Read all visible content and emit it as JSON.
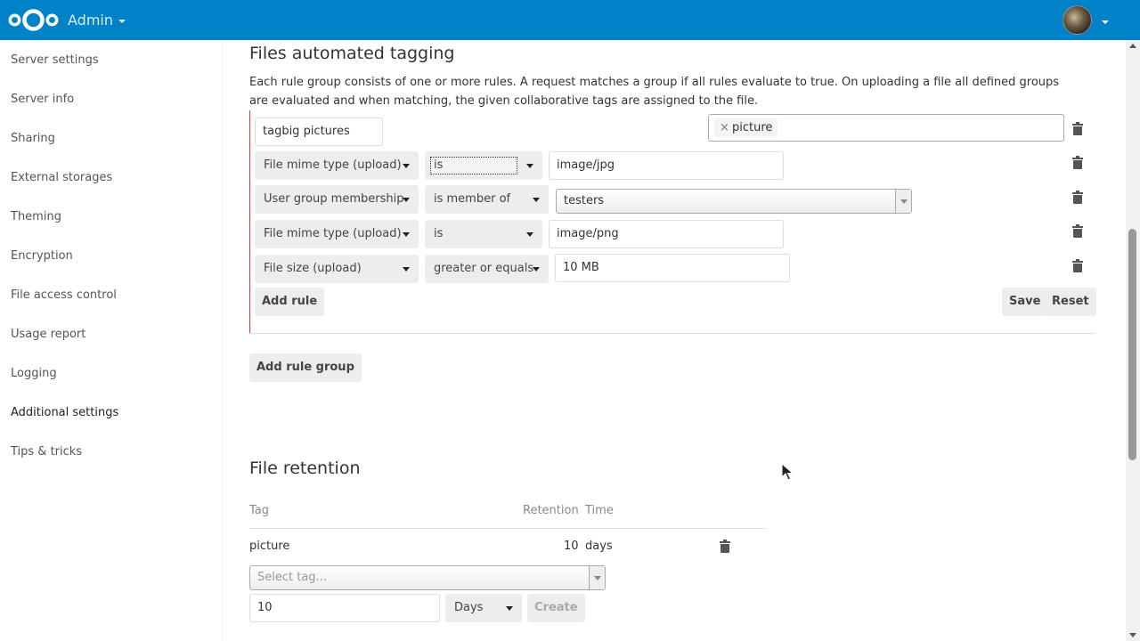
{
  "header": {
    "app_title": "Admin",
    "logo": "nextcloud-logo",
    "brand_color": "#0082c9"
  },
  "sidebar": {
    "items": [
      {
        "label": "Server settings"
      },
      {
        "label": "Server info"
      },
      {
        "label": "Sharing"
      },
      {
        "label": "External storages"
      },
      {
        "label": "Theming"
      },
      {
        "label": "Encryption"
      },
      {
        "label": "File access control"
      },
      {
        "label": "Usage report"
      },
      {
        "label": "Logging"
      },
      {
        "label": "Additional settings",
        "active": true
      },
      {
        "label": "Tips & tricks"
      }
    ]
  },
  "tagging": {
    "title": "Files automated tagging",
    "description": "Each rule group consists of one or more rules. A request matches a group if all rules evaluate to true. On uploading a file all defined groups are evaluated and when matching, the given collaborative tags are assigned to the file.",
    "group_name": "tagbig  pictures",
    "tags": [
      "picture"
    ],
    "rules": [
      {
        "check": "File mime type (upload)",
        "operator": "is",
        "value": "image/jpg"
      },
      {
        "check": "User group membership",
        "operator": "is member of",
        "value": "testers"
      },
      {
        "check": "File mime type (upload)",
        "operator": "is",
        "value": "image/png"
      },
      {
        "check": "File size (upload)",
        "operator": "greater or equals",
        "value": "10 MB"
      }
    ],
    "add_rule_label": "Add rule",
    "save_label": "Save",
    "reset_label": "Reset",
    "add_group_label": "Add rule group",
    "error_color": "#e9322d"
  },
  "retention": {
    "title": "File retention",
    "columns": {
      "tag": "Tag",
      "retention": "Retention",
      "time": "Time"
    },
    "rows": [
      {
        "tag": "picture",
        "retention": "10",
        "time": "days"
      }
    ],
    "select_tag_placeholder": "Select tag...",
    "amount_value": "10",
    "unit_value": "Days",
    "create_label": "Create"
  }
}
